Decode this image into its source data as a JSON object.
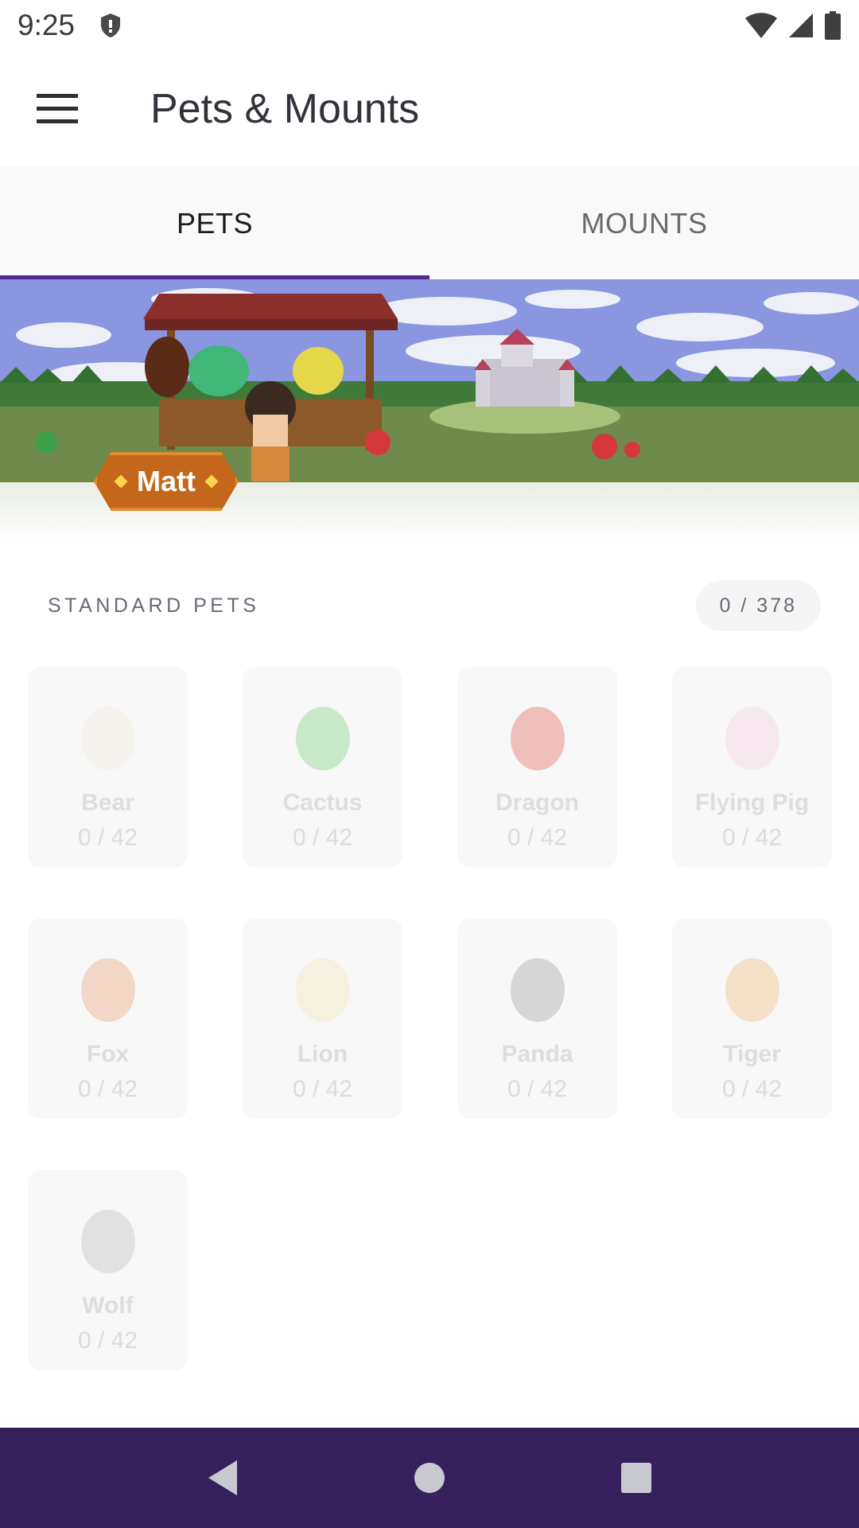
{
  "status_bar": {
    "time": "9:25"
  },
  "app_bar": {
    "title": "Pets & Mounts"
  },
  "tabs": [
    {
      "label": "PETS",
      "active": true
    },
    {
      "label": "MOUNTS",
      "active": false
    }
  ],
  "banner": {
    "user_name": "Matt"
  },
  "section": {
    "title": "STANDARD PETS",
    "count": "0 / 378"
  },
  "pets": [
    {
      "name": "Bear",
      "count": "0 / 42",
      "egg_color": "#f3e9dc"
    },
    {
      "name": "Cactus",
      "count": "0 / 42",
      "egg_color": "#6fcf77"
    },
    {
      "name": "Dragon",
      "count": "0 / 42",
      "egg_color": "#e2564f"
    },
    {
      "name": "Flying Pig",
      "count": "0 / 42",
      "egg_color": "#f6cde4"
    },
    {
      "name": "Fox",
      "count": "0 / 42",
      "egg_color": "#e8996a"
    },
    {
      "name": "Lion",
      "count": "0 / 42",
      "egg_color": "#f1e2b5"
    },
    {
      "name": "Panda",
      "count": "0 / 42",
      "egg_color": "#9a9a9a"
    },
    {
      "name": "Tiger",
      "count": "0 / 42",
      "egg_color": "#efb872"
    },
    {
      "name": "Wolf",
      "count": "0 / 42",
      "egg_color": "#b9b9b9"
    }
  ],
  "colors": {
    "accent": "#4f2a93",
    "nav_bar": "#36205c",
    "name_plate": "#c5671a"
  }
}
